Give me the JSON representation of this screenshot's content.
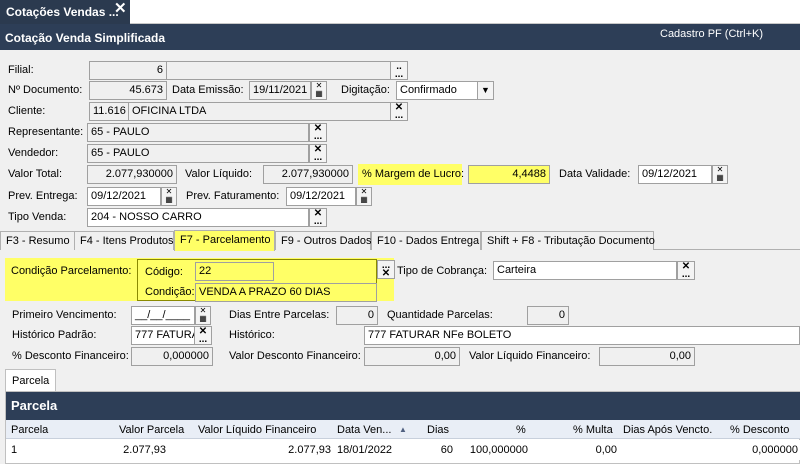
{
  "window": {
    "tab_title": "Cotações Vendas ...",
    "close_glyph": "✕",
    "header_title": "Cotação Venda Simplificada",
    "shortcut": "Cadastro PF (Ctrl+K)"
  },
  "form": {
    "filial_label": "Filial:",
    "filial_value": "6",
    "documento_label": "Nº Documento:",
    "documento_value": "45.673",
    "data_emissao_label": "Data Emissão:",
    "data_emissao_value": "19/11/2021",
    "digitacao_label": "Digitação:",
    "digitacao_value": "Confirmado",
    "cliente_label": "Cliente:",
    "cliente_code": "11.616",
    "cliente_name": "OFICINA LTDA",
    "representante_label": "Representante:",
    "representante_value": "65 - PAULO",
    "vendedor_label": "Vendedor:",
    "vendedor_value": "65 - PAULO",
    "valor_total_label": "Valor Total:",
    "valor_total_value": "2.077,930000",
    "valor_liquido_label": "Valor Líquido:",
    "valor_liquido_value": "2.077,930000",
    "margem_label": "% Margem de Lucro:",
    "margem_value": "4,4488",
    "data_validade_label": "Data Validade:",
    "data_validade_value": "09/12/2021",
    "prev_entrega_label": "Prev. Entrega:",
    "prev_entrega_value": "09/12/2021",
    "prev_faturamento_label": "Prev. Faturamento:",
    "prev_faturamento_value": "09/12/2021",
    "tipo_venda_label": "Tipo Venda:",
    "tipo_venda_value": "204 - NOSSO CARRO"
  },
  "tabs": [
    "F3 - Resumo",
    "F4 - Itens Produtos",
    "F7 - Parcelamento",
    "F9 - Outros Dados",
    "F10 - Dados Entrega",
    "Shift + F8 - Tributação Documento"
  ],
  "parcelamento": {
    "condicao_label": "Condição Parcelamento:",
    "codigo_label": "Código:",
    "codigo_value": "22",
    "condicao_field_label": "Condição:",
    "condicao_value": "VENDA A PRAZO 60 DIAS",
    "tipo_cobranca_label": "Tipo de Cobrança:",
    "tipo_cobranca_value": "Carteira",
    "primeiro_venc_label": "Primeiro Vencimento:",
    "primeiro_venc_value": "__/__/____",
    "dias_entre_label": "Dias Entre Parcelas:",
    "dias_entre_value": "0",
    "qtd_parcelas_label": "Quantidade Parcelas:",
    "qtd_parcelas_value": "0",
    "historico_padrao_label": "Histórico Padrão:",
    "historico_padrao_value": "777 FATURA",
    "historico_label": "Histórico:",
    "historico_value": "777 FATURAR NFe BOLETO",
    "desc_fin_label": "% Desconto Financeiro:",
    "desc_fin_value": "0,000000",
    "valor_desc_label": "Valor Desconto Financeiro:",
    "valor_desc_value": "0,00",
    "valor_liq_fin_label": "Valor Líquido Financeiro:",
    "valor_liq_fin_value": "0,00"
  },
  "parcela": {
    "subtab": "Parcela",
    "panel_title": "Parcela",
    "columns": [
      "Parcela",
      "Valor Parcela",
      "Valor Líquido Financeiro",
      "Data Ven...",
      "Dias",
      "%",
      "% Multa",
      "Dias Após Vencto.",
      "% Desconto"
    ],
    "sort_glyph": "▲",
    "rows": [
      [
        "1",
        "2.077,93",
        "2.077,93",
        "18/01/2022",
        "60",
        "100,000000",
        "0,00",
        "",
        "0,000000"
      ]
    ]
  },
  "colors": {
    "header": "#2d3e57",
    "highlight": "#ffff66"
  }
}
